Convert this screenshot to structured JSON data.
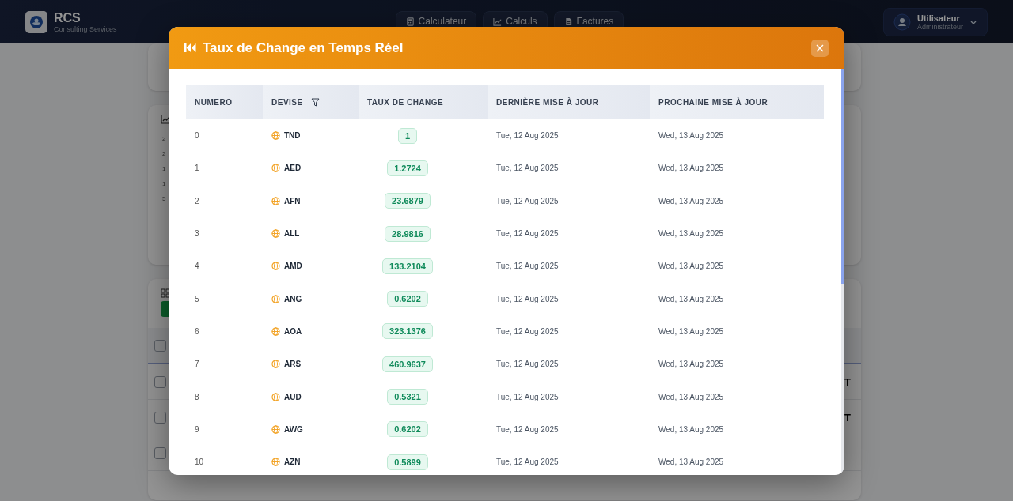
{
  "header": {
    "brand": "RCS",
    "tagline": "Consulting Services",
    "nav": [
      {
        "label": "Calculateur"
      },
      {
        "label": "Calculs"
      },
      {
        "label": "Factures"
      }
    ],
    "user": {
      "name": "Utilisateur",
      "role": "Administrateur"
    }
  },
  "background": {
    "chart_ticks": [
      "2",
      "2",
      "1",
      "1",
      "5"
    ],
    "header_checked": false,
    "rows": [
      {
        "checked": false,
        "fragment": "T"
      },
      {
        "checked": false,
        "fragment": "T"
      },
      {
        "checked": false
      }
    ]
  },
  "modal": {
    "title": "Taux de Change en Temps Réel",
    "columns": [
      {
        "label": "NUMERO",
        "filter": false
      },
      {
        "label": "DEVISE",
        "filter": true
      },
      {
        "label": "TAUX DE CHANGE",
        "filter": false
      },
      {
        "label": "DERNIÈRE MISE À JOUR",
        "filter": false
      },
      {
        "label": "PROCHAINE MISE À JOUR",
        "filter": false
      }
    ],
    "rows": [
      {
        "numero": "0",
        "devise": "TND",
        "taux": "1",
        "derniere": "Tue, 12 Aug 2025",
        "prochaine": "Wed, 13 Aug 2025"
      },
      {
        "numero": "1",
        "devise": "AED",
        "taux": "1.2724",
        "derniere": "Tue, 12 Aug 2025",
        "prochaine": "Wed, 13 Aug 2025"
      },
      {
        "numero": "2",
        "devise": "AFN",
        "taux": "23.6879",
        "derniere": "Tue, 12 Aug 2025",
        "prochaine": "Wed, 13 Aug 2025"
      },
      {
        "numero": "3",
        "devise": "ALL",
        "taux": "28.9816",
        "derniere": "Tue, 12 Aug 2025",
        "prochaine": "Wed, 13 Aug 2025"
      },
      {
        "numero": "4",
        "devise": "AMD",
        "taux": "133.2104",
        "derniere": "Tue, 12 Aug 2025",
        "prochaine": "Wed, 13 Aug 2025"
      },
      {
        "numero": "5",
        "devise": "ANG",
        "taux": "0.6202",
        "derniere": "Tue, 12 Aug 2025",
        "prochaine": "Wed, 13 Aug 2025"
      },
      {
        "numero": "6",
        "devise": "AOA",
        "taux": "323.1376",
        "derniere": "Tue, 12 Aug 2025",
        "prochaine": "Wed, 13 Aug 2025"
      },
      {
        "numero": "7",
        "devise": "ARS",
        "taux": "460.9637",
        "derniere": "Tue, 12 Aug 2025",
        "prochaine": "Wed, 13 Aug 2025"
      },
      {
        "numero": "8",
        "devise": "AUD",
        "taux": "0.5321",
        "derniere": "Tue, 12 Aug 2025",
        "prochaine": "Wed, 13 Aug 2025"
      },
      {
        "numero": "9",
        "devise": "AWG",
        "taux": "0.6202",
        "derniere": "Tue, 12 Aug 2025",
        "prochaine": "Wed, 13 Aug 2025"
      },
      {
        "numero": "10",
        "devise": "AZN",
        "taux": "0.5899",
        "derniere": "Tue, 12 Aug 2025",
        "prochaine": "Wed, 13 Aug 2025"
      }
    ]
  }
}
